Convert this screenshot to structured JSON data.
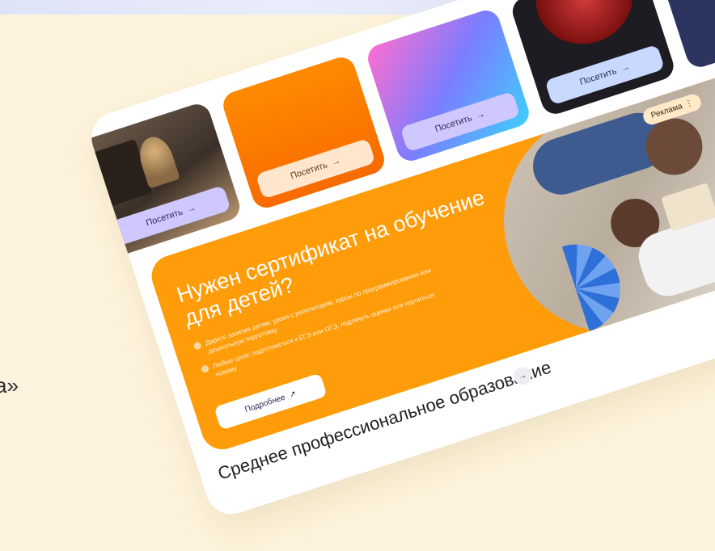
{
  "background": {
    "partial_text": "а»"
  },
  "tiles": [
    {
      "button_label": "Посетить",
      "arrow": "→"
    },
    {
      "button_label": "Посетить",
      "arrow": "→"
    },
    {
      "button_label": "Посетить",
      "arrow": "→"
    },
    {
      "button_label": "Посетить",
      "arrow": "→"
    },
    {
      "button_label": "",
      "arrow": ""
    }
  ],
  "banner": {
    "headline": "Нужен сертификат на обучение для детей?",
    "bullets": [
      "Дарите занятия детям: уроки с репетитором, курсы по программированию или дошкольную подготовку",
      "Любые цели: подготовиться к ЕГЭ или ОГЭ, подтянуть оценки или научиться новому"
    ],
    "details_label": "Подробнее",
    "details_arrow": "↗",
    "ad_label": "Реклама",
    "ad_menu": "⋮",
    "next_arrow": "←"
  },
  "section": {
    "title": "Среднее профессиональное образование",
    "arrow": "→"
  },
  "colors": {
    "banner": "#ff9c0a",
    "background": "#fdf3dc",
    "card": "#ffffff",
    "visit_button": "#cfc8ff"
  }
}
